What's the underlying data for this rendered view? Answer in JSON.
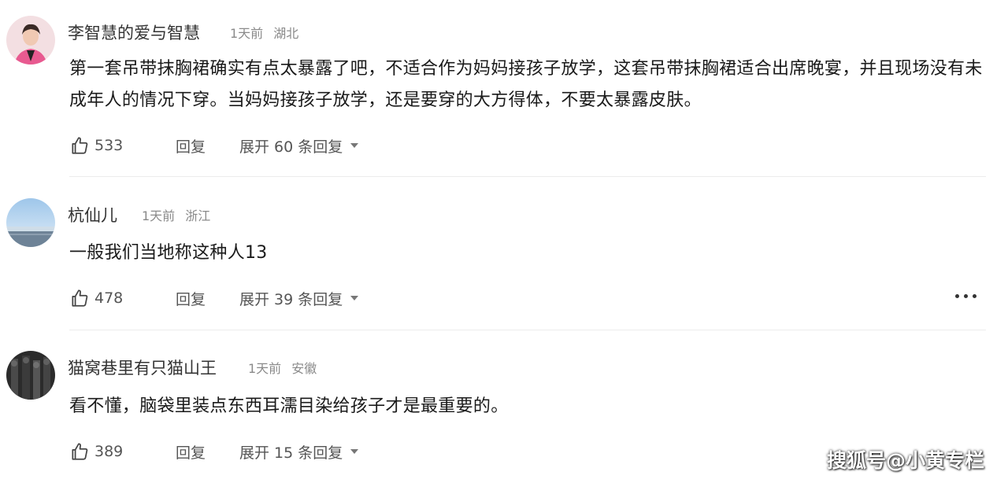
{
  "comments": [
    {
      "username": "李智慧的爱与智慧",
      "time": "1天前",
      "location": "湖北",
      "text": "第一套吊带抹胸裙确实有点太暴露了吧，不适合作为妈妈接孩子放学，这套吊带抹胸裙适合出席晚宴，并且现场没有未成年人的情况下穿。当妈妈接孩子放学，还是要穿的大方得体，不要太暴露皮肤。",
      "likes": "533",
      "reply_label": "回复",
      "expand_label": "展开 60 条回复"
    },
    {
      "username": "杭仙儿",
      "time": "1天前",
      "location": "浙江",
      "text": "一般我们当地称这种人13",
      "likes": "478",
      "reply_label": "回复",
      "expand_label": "展开 39 条回复"
    },
    {
      "username": "猫窝巷里有只猫山王",
      "time": "1天前",
      "location": "安徽",
      "text": "看不懂，脑袋里装点东西耳濡目染给孩子才是最重要的。",
      "likes": "389",
      "reply_label": "回复",
      "expand_label": "展开 15 条回复"
    }
  ],
  "icons": {
    "like": "thumbs-up-icon",
    "more": "more-options-icon",
    "expand": "chevron-down-icon"
  },
  "watermark": "搜狐号@小黄专栏"
}
